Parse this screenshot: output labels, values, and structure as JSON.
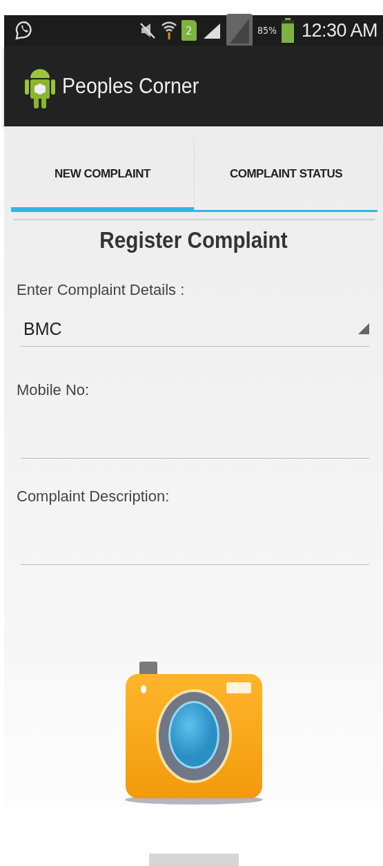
{
  "status_bar": {
    "sim_slot": "2",
    "battery": {
      "percent": "85%",
      "level": 0.85
    },
    "time": "12:30 AM"
  },
  "app_bar": {
    "title": "Peoples Corner"
  },
  "tabs": [
    {
      "label": "NEW COMPLAINT",
      "selected": true
    },
    {
      "label": "COMPLAINT STATUS",
      "selected": false
    }
  ],
  "form": {
    "heading": "Register Complaint",
    "details_label": "Enter Complaint Details :",
    "category_value": "BMC",
    "mobile_label": "Mobile No:",
    "description_label": "Complaint Description:"
  }
}
